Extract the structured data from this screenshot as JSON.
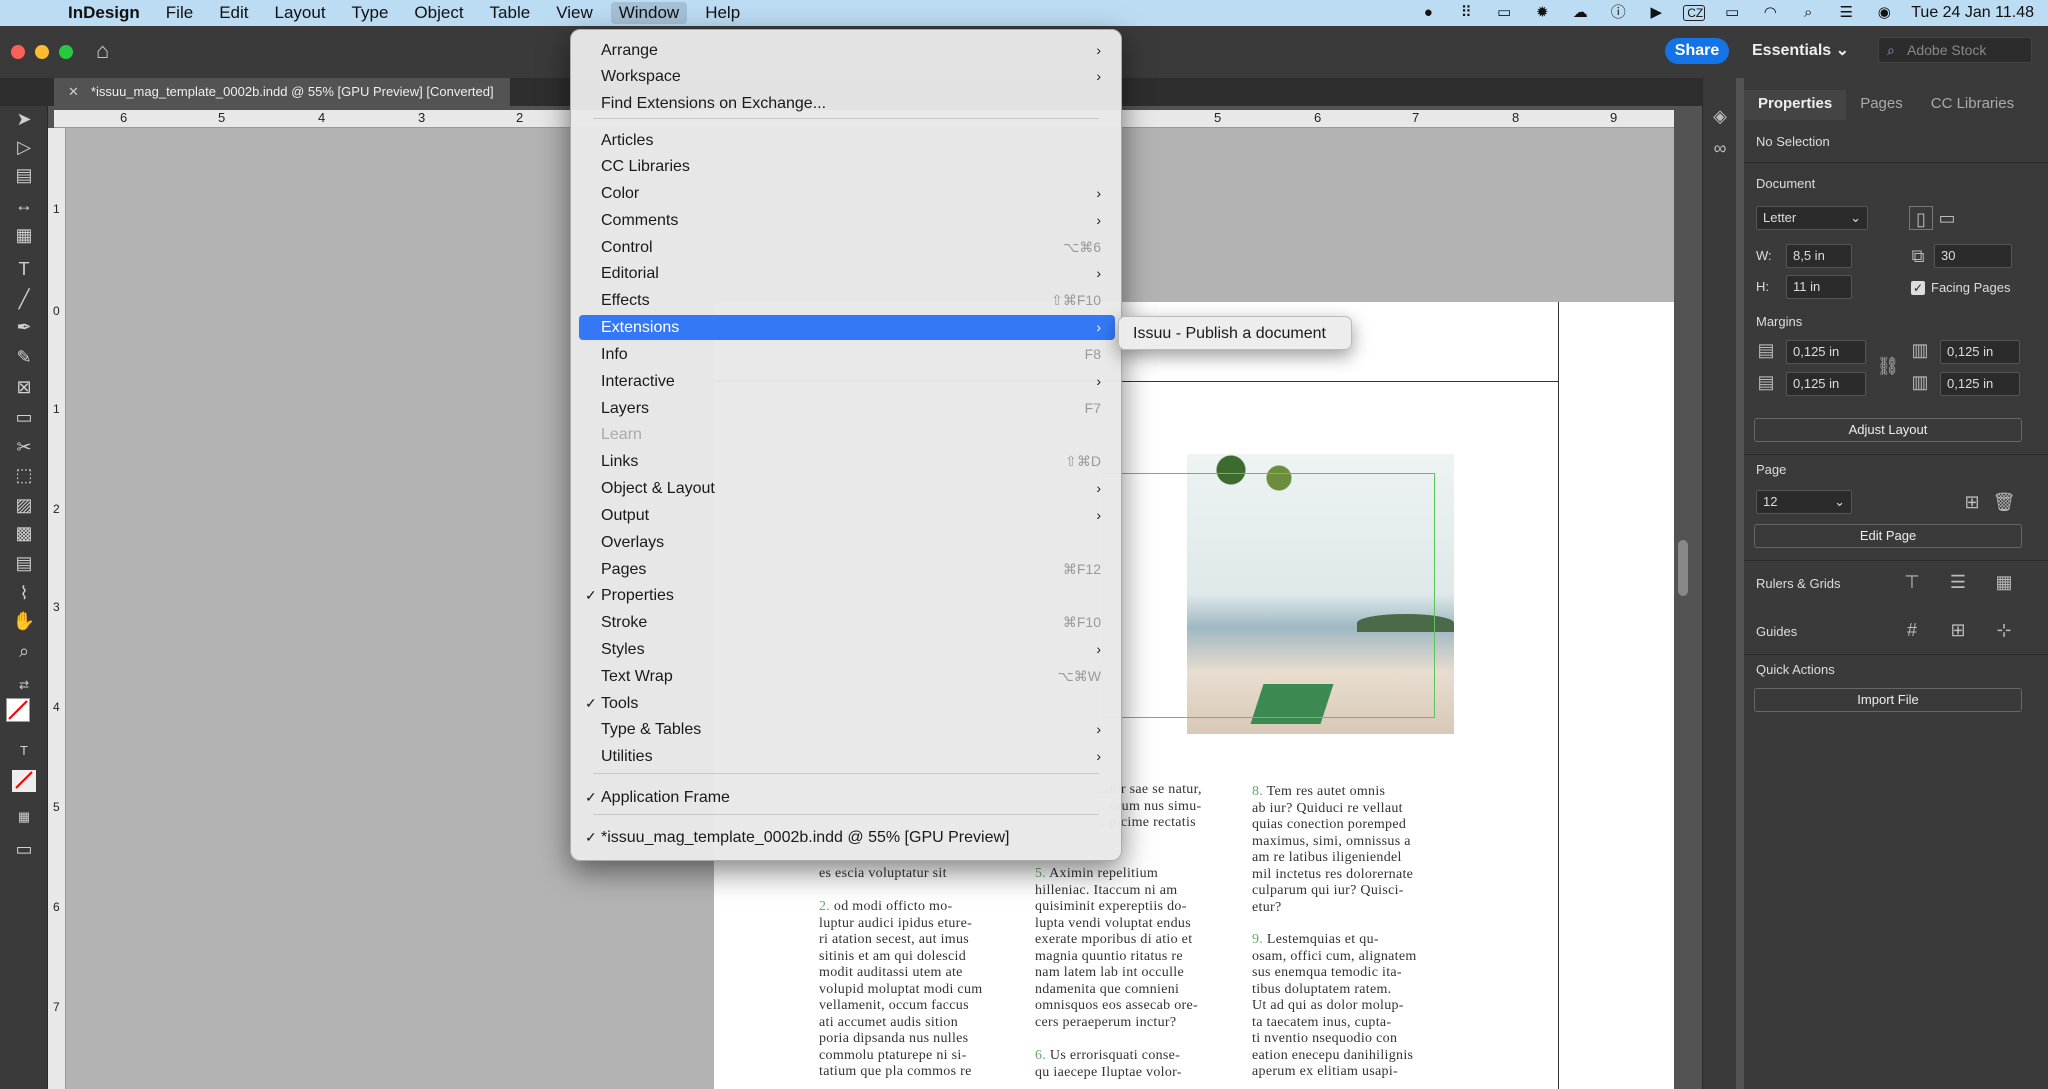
{
  "menubar": {
    "app_name": "InDesign",
    "items": [
      "File",
      "Edit",
      "Layout",
      "Type",
      "Object",
      "Table",
      "View",
      "Window",
      "Help"
    ],
    "active": "Window",
    "clock": "Tue 24 Jan  11.48",
    "keyboard_layout": "CZ"
  },
  "appbar": {
    "share_label": "Share",
    "workspace_label": "Essentials",
    "stock_placeholder": "Adobe Stock"
  },
  "document_tab": {
    "title": "*issuu_mag_template_0002b.indd @ 55% [GPU Preview] [Converted]"
  },
  "ruler": {
    "top_labels": [
      "6",
      "5",
      "4",
      "3",
      "2",
      "5",
      "6",
      "7",
      "8",
      "9"
    ],
    "left_labels": [
      "1",
      "0",
      "1",
      "2",
      "3",
      "4",
      "5",
      "6",
      "7"
    ]
  },
  "window_menu": {
    "items": [
      {
        "label": "Arrange",
        "submenu": true
      },
      {
        "label": "Workspace",
        "submenu": true
      },
      {
        "label": "Find Extensions on Exchange..."
      },
      {
        "label": "Articles"
      },
      {
        "label": "CC Libraries"
      },
      {
        "label": "Color",
        "submenu": true
      },
      {
        "label": "Comments",
        "submenu": true
      },
      {
        "label": "Control",
        "shortcut": "⌥⌘6"
      },
      {
        "label": "Editorial",
        "submenu": true
      },
      {
        "label": "Effects",
        "shortcut": "⇧⌘F10"
      },
      {
        "label": "Extensions",
        "submenu": true,
        "highlighted": true
      },
      {
        "label": "Info",
        "shortcut": "F8"
      },
      {
        "label": "Interactive",
        "submenu": true
      },
      {
        "label": "Layers",
        "shortcut": "F7"
      },
      {
        "label": "Learn",
        "disabled": true
      },
      {
        "label": "Links",
        "shortcut": "⇧⌘D"
      },
      {
        "label": "Object & Layout",
        "submenu": true
      },
      {
        "label": "Output",
        "submenu": true
      },
      {
        "label": "Overlays"
      },
      {
        "label": "Pages",
        "shortcut": "⌘F12"
      },
      {
        "label": "Properties",
        "checked": true
      },
      {
        "label": "Stroke",
        "shortcut": "⌘F10"
      },
      {
        "label": "Styles",
        "submenu": true
      },
      {
        "label": "Text Wrap",
        "shortcut": "⌥⌘W"
      },
      {
        "label": "Tools",
        "checked": true
      },
      {
        "label": "Type & Tables",
        "submenu": true
      },
      {
        "label": "Utilities",
        "submenu": true
      },
      {
        "label": "Application Frame",
        "checked": true
      },
      {
        "label": "*issuu_mag_template_0002b.indd @ 55% [GPU Preview]",
        "checked": true
      }
    ],
    "extensions_submenu": [
      "Issuu - Publish a document"
    ]
  },
  "properties_panel": {
    "tabs": [
      "Properties",
      "Pages",
      "CC Libraries"
    ],
    "selection": "No Selection",
    "document_heading": "Document",
    "page_size": "Letter",
    "width_label": "W:",
    "width": "8,5 in",
    "height_label": "H:",
    "height": "11 in",
    "pages_count": "30",
    "facing_pages_label": "Facing Pages",
    "facing_pages_checked": true,
    "margins_heading": "Margins",
    "margin_top": "0,125 in",
    "margin_bottom": "0,125 in",
    "margin_inside": "0,125 in",
    "margin_outside": "0,125 in",
    "adjust_layout_label": "Adjust Layout",
    "page_heading": "Page",
    "page_number": "12",
    "edit_page_label": "Edit Page",
    "rulers_grids_label": "Rulers & Grids",
    "guides_label": "Guides",
    "quick_actions_label": "Quick Actions",
    "import_file_label": "Import File"
  },
  "page_text": {
    "col1_top": "...tur sae se natur,\n...orum nus simu-\n...picime rectatis",
    "col1": "es escia voluptatur sit",
    "col1_num2": "2.",
    "col1_para2": " od modi officto mo-\nluptur audici ipidus eture-\nri atation secest, aut imus\nsitinis et am qui dolescid\nmodit auditassi utem ate\nvolupid moluptat modi cum\nvellamenit, occum faccus\nati accumet audis sition\nporia dipsanda nus nulles\ncommolu ptaturepe ni si-\ntatium que pla commos re",
    "col2_num5": "5.",
    "col2_para5": " Aximin repelitium\nhilleniac. Itaccum ni am\nquisiminit expereptiis do-\nlupta vendi voluptat endus\nexerate mporibus di atio et\nmagnia quuntio ritatus re\nnam latem lab int occulle\nndamenita que comnieni\nomnisquos eos assecab ore-\ncers peraeperum inctur?",
    "col2_num6": "6.",
    "col2_para6": " Us errorisquati conse-\nqu iaecepe Iluptae volor-",
    "col3_num8": "8.",
    "col3_para8": " Tem res autet omnis\nab iur? Quiduci re vellaut\nquias conection poremped\nmaximus, simi, omnissus a\nam re latibus iligeniendel\nmil inctetus res dolorernate\nculparum qui iur? Quisci-\netur?",
    "col3_num9": "9.",
    "col3_para9": " Lestemquias et qu-\nosam, offici cum, alignatem\nsus enemqua temodic ita-\ntibus doluptatem ratem.\nUt ad qui as dolor molup-\nta taecatem inus, cupta-\nti nventio nsequodio con\neation enecepu danihilignis\naperum ex elitiam usapi-"
  }
}
